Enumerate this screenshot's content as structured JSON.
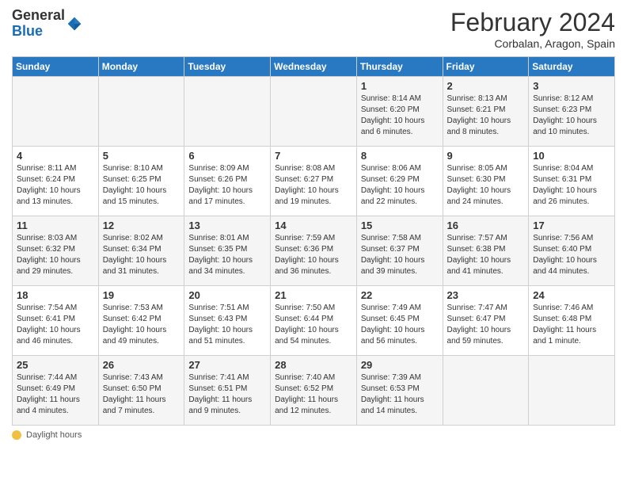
{
  "header": {
    "logo_general": "General",
    "logo_blue": "Blue",
    "month_title": "February 2024",
    "subtitle": "Corbalan, Aragon, Spain"
  },
  "calendar": {
    "days_of_week": [
      "Sunday",
      "Monday",
      "Tuesday",
      "Wednesday",
      "Thursday",
      "Friday",
      "Saturday"
    ],
    "weeks": [
      [
        {
          "day": "",
          "text": ""
        },
        {
          "day": "",
          "text": ""
        },
        {
          "day": "",
          "text": ""
        },
        {
          "day": "",
          "text": ""
        },
        {
          "day": "1",
          "text": "Sunrise: 8:14 AM\nSunset: 6:20 PM\nDaylight: 10 hours and 6 minutes."
        },
        {
          "day": "2",
          "text": "Sunrise: 8:13 AM\nSunset: 6:21 PM\nDaylight: 10 hours and 8 minutes."
        },
        {
          "day": "3",
          "text": "Sunrise: 8:12 AM\nSunset: 6:23 PM\nDaylight: 10 hours and 10 minutes."
        }
      ],
      [
        {
          "day": "4",
          "text": "Sunrise: 8:11 AM\nSunset: 6:24 PM\nDaylight: 10 hours and 13 minutes."
        },
        {
          "day": "5",
          "text": "Sunrise: 8:10 AM\nSunset: 6:25 PM\nDaylight: 10 hours and 15 minutes."
        },
        {
          "day": "6",
          "text": "Sunrise: 8:09 AM\nSunset: 6:26 PM\nDaylight: 10 hours and 17 minutes."
        },
        {
          "day": "7",
          "text": "Sunrise: 8:08 AM\nSunset: 6:27 PM\nDaylight: 10 hours and 19 minutes."
        },
        {
          "day": "8",
          "text": "Sunrise: 8:06 AM\nSunset: 6:29 PM\nDaylight: 10 hours and 22 minutes."
        },
        {
          "day": "9",
          "text": "Sunrise: 8:05 AM\nSunset: 6:30 PM\nDaylight: 10 hours and 24 minutes."
        },
        {
          "day": "10",
          "text": "Sunrise: 8:04 AM\nSunset: 6:31 PM\nDaylight: 10 hours and 26 minutes."
        }
      ],
      [
        {
          "day": "11",
          "text": "Sunrise: 8:03 AM\nSunset: 6:32 PM\nDaylight: 10 hours and 29 minutes."
        },
        {
          "day": "12",
          "text": "Sunrise: 8:02 AM\nSunset: 6:34 PM\nDaylight: 10 hours and 31 minutes."
        },
        {
          "day": "13",
          "text": "Sunrise: 8:01 AM\nSunset: 6:35 PM\nDaylight: 10 hours and 34 minutes."
        },
        {
          "day": "14",
          "text": "Sunrise: 7:59 AM\nSunset: 6:36 PM\nDaylight: 10 hours and 36 minutes."
        },
        {
          "day": "15",
          "text": "Sunrise: 7:58 AM\nSunset: 6:37 PM\nDaylight: 10 hours and 39 minutes."
        },
        {
          "day": "16",
          "text": "Sunrise: 7:57 AM\nSunset: 6:38 PM\nDaylight: 10 hours and 41 minutes."
        },
        {
          "day": "17",
          "text": "Sunrise: 7:56 AM\nSunset: 6:40 PM\nDaylight: 10 hours and 44 minutes."
        }
      ],
      [
        {
          "day": "18",
          "text": "Sunrise: 7:54 AM\nSunset: 6:41 PM\nDaylight: 10 hours and 46 minutes."
        },
        {
          "day": "19",
          "text": "Sunrise: 7:53 AM\nSunset: 6:42 PM\nDaylight: 10 hours and 49 minutes."
        },
        {
          "day": "20",
          "text": "Sunrise: 7:51 AM\nSunset: 6:43 PM\nDaylight: 10 hours and 51 minutes."
        },
        {
          "day": "21",
          "text": "Sunrise: 7:50 AM\nSunset: 6:44 PM\nDaylight: 10 hours and 54 minutes."
        },
        {
          "day": "22",
          "text": "Sunrise: 7:49 AM\nSunset: 6:45 PM\nDaylight: 10 hours and 56 minutes."
        },
        {
          "day": "23",
          "text": "Sunrise: 7:47 AM\nSunset: 6:47 PM\nDaylight: 10 hours and 59 minutes."
        },
        {
          "day": "24",
          "text": "Sunrise: 7:46 AM\nSunset: 6:48 PM\nDaylight: 11 hours and 1 minute."
        }
      ],
      [
        {
          "day": "25",
          "text": "Sunrise: 7:44 AM\nSunset: 6:49 PM\nDaylight: 11 hours and 4 minutes."
        },
        {
          "day": "26",
          "text": "Sunrise: 7:43 AM\nSunset: 6:50 PM\nDaylight: 11 hours and 7 minutes."
        },
        {
          "day": "27",
          "text": "Sunrise: 7:41 AM\nSunset: 6:51 PM\nDaylight: 11 hours and 9 minutes."
        },
        {
          "day": "28",
          "text": "Sunrise: 7:40 AM\nSunset: 6:52 PM\nDaylight: 11 hours and 12 minutes."
        },
        {
          "day": "29",
          "text": "Sunrise: 7:39 AM\nSunset: 6:53 PM\nDaylight: 11 hours and 14 minutes."
        },
        {
          "day": "",
          "text": ""
        },
        {
          "day": "",
          "text": ""
        }
      ]
    ]
  },
  "footer": {
    "daylight_label": "Daylight hours"
  }
}
